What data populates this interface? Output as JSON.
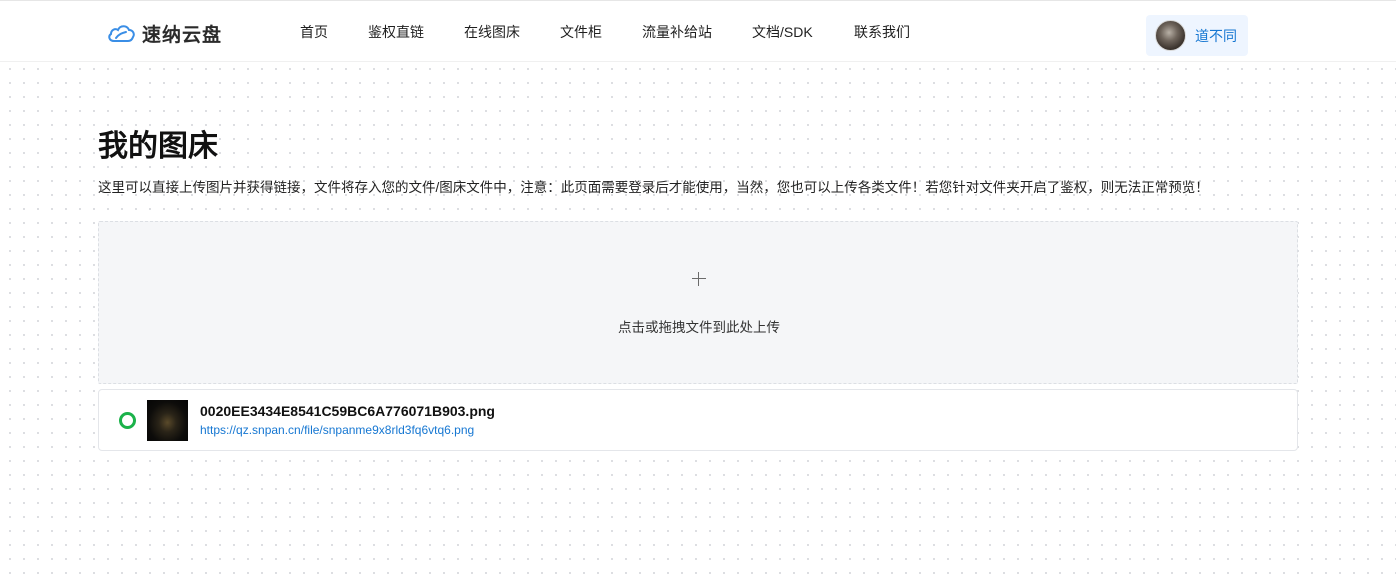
{
  "header": {
    "logo_text": "速纳云盘",
    "nav": [
      {
        "label": "首页"
      },
      {
        "label": "鉴权直链"
      },
      {
        "label": "在线图床"
      },
      {
        "label": "文件柜"
      },
      {
        "label": "流量补给站"
      },
      {
        "label": "文档/SDK"
      },
      {
        "label": "联系我们"
      }
    ],
    "user": {
      "name": "道不同"
    }
  },
  "main": {
    "title": "我的图床",
    "description": "这里可以直接上传图片并获得链接，文件将存入您的文件/图床文件中，注意：此页面需要登录后才能使用，当然，您也可以上传各类文件！若您针对文件夹开启了鉴权，则无法正常预览！",
    "upload": {
      "icon": "plus-icon",
      "text": "点击或拖拽文件到此处上传"
    },
    "files": [
      {
        "name": "0020EE3434E8541C59BC6A776071B903.png",
        "url": "https://qz.snpan.cn/file/snpanme9x8rld3fq6vtq6.png",
        "status_color": "#1bb24a"
      }
    ]
  },
  "colors": {
    "accent": "#1677d2",
    "success": "#1bb24a"
  }
}
